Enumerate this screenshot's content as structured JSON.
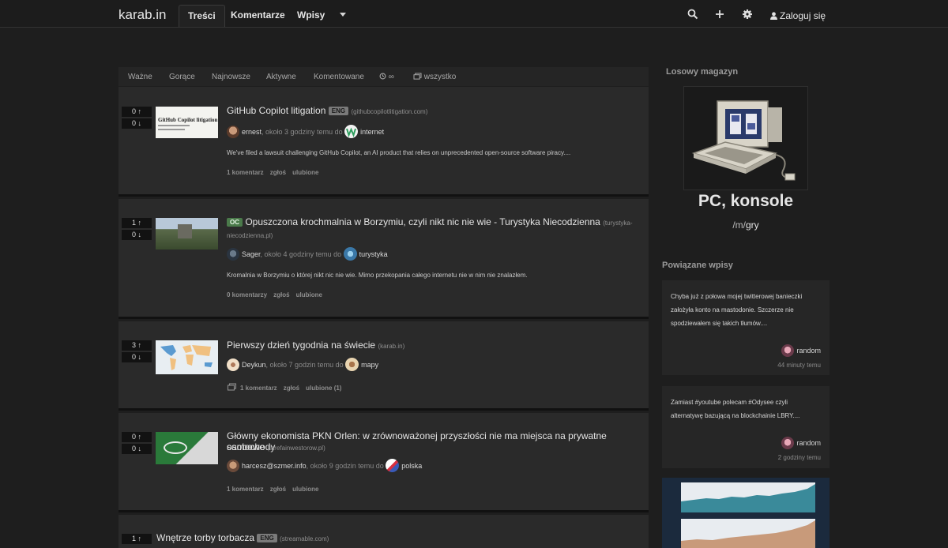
{
  "header": {
    "logo": "karab.in",
    "tabs": [
      "Treści",
      "Komentarze",
      "Wpisy"
    ],
    "login": "Zaloguj się"
  },
  "sort_tabs": [
    "Ważne",
    "Gorące",
    "Najnowsze",
    "Aktywne",
    "Komentowane",
    "∞",
    "wszystko"
  ],
  "posts": [
    {
      "up": "0 ↑",
      "down": "0 ↓",
      "title": "GitHub Copilot litigation",
      "tag": "ENG",
      "domain": "(githubcopilotlitigation.com)",
      "thumb_text": "GitHub Copilot litigation",
      "user": "ernest",
      "time": ", około 3 godziny temu do ",
      "magazine": "internet",
      "excerpt": "We've filed a lawsuit challenging GitHub Copilot, an AI product that relies on unprecedented open-source software piracy....",
      "comments": "1 komentarz",
      "report": "zgłoś",
      "fav": "ulubione"
    },
    {
      "up": "1 ↑",
      "down": "0 ↓",
      "title": "Opuszczona krochmalnia w Borzymiu, czyli nikt nic nie wie - Turystyka Niecodzienna",
      "tag": "OC",
      "domain_a": "(turystyka-",
      "domain_b": "niecodzienna.pl)",
      "user": "Sager",
      "time": ", około 4 godziny temu do ",
      "magazine": "turystyka",
      "excerpt": "Kromalnia w Borzymiu o której nikt nic nie wie. Mimo przekopania całego internetu nie w nim nie znalazłem.",
      "comments": "0 komentarzy",
      "report": "zgłoś",
      "fav": "ulubione"
    },
    {
      "up": "3 ↑",
      "down": "0 ↓",
      "title": "Pierwszy dzień tygodnia na świecie",
      "domain": "(karab.in)",
      "user": "Deykun",
      "time": ", około 7 godzin temu do ",
      "magazine": "mapy",
      "comments": "1 komentarz",
      "report": "zgłoś",
      "fav": "ulubione (1)"
    },
    {
      "up": "0 ↑",
      "down": "0 ↓",
      "title_a": "Główny ekonomista PKN Orlen: w zrównoważonej przyszłości nie ma miejsca na prywatne samochody",
      "title_b": "osobowe",
      "domain": "(strefainwestorow.pl)",
      "user": "harcesz@szmer.info",
      "time": ", około 9 godzin temu do ",
      "magazine": "polska",
      "comments": "1 komentarz",
      "report": "zgłoś",
      "fav": "ulubione"
    },
    {
      "up": "1 ↑",
      "title": "Wnętrze torby torbacza",
      "tag": "ENG",
      "domain": "(streamable.com)"
    }
  ],
  "sidebar": {
    "random_heading": "Losowy magazyn",
    "magazine_name": "PC, konsole",
    "magazine_prefix": "/m/",
    "magazine_slug": "gry",
    "related_heading": "Powiązane wpisy",
    "related": [
      {
        "text": "Chyba już z połowa mojej twitterowej banieczki założyła konto na mastodonie. Szczerze nie spodziewałem się takich tłumów....",
        "user": "random",
        "time": "44 minuty temu"
      },
      {
        "text": "Zamiast #youtube polecam #Odysee czyli alternatywę bazującą na blockchainie LBRY....",
        "user": "random",
        "time": "2 godziny temu"
      }
    ]
  },
  "colors": {
    "background": "#1e1e1e",
    "card": "#2a2a2a",
    "oc_tag": "#4a7a4a",
    "eng_tag": "#7a7a7a"
  }
}
